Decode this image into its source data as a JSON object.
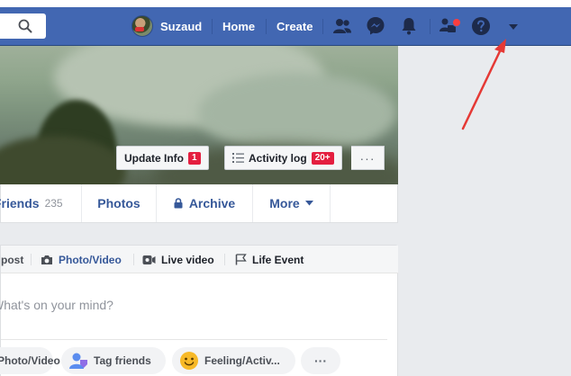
{
  "header": {
    "profile_name": "Suzaud",
    "home_label": "Home",
    "create_label": "Create",
    "icons": [
      "search-icon",
      "friend-requests-icon",
      "messenger-icon",
      "notifications-icon",
      "quick-help-icon",
      "help-icon",
      "account-menu-chevron-icon"
    ]
  },
  "cover": {
    "update_info_label": "Update Info",
    "update_info_count": "1",
    "activity_log_label": "Activity log",
    "activity_log_count": "20+",
    "more_dots": "···"
  },
  "tabs": {
    "friends_label": "Friends",
    "friends_count": "235",
    "photos_label": "Photos",
    "archive_label": "Archive",
    "more_label": "More"
  },
  "composer": {
    "post_label": "post",
    "photo_video_label": "Photo/Video",
    "live_video_label": "Live video",
    "life_event_label": "Life Event",
    "placeholder": "What's on your mind?",
    "photo_video_pill": "Photo/Video",
    "tag_friends_pill": "Tag friends",
    "feeling_pill": "Feeling/Activ...",
    "more_pill": "···"
  },
  "colors": {
    "nav_blue": "#4267b2",
    "link_blue": "#365899",
    "badge_red": "#e41e3f",
    "arrow_red": "#e53935"
  }
}
